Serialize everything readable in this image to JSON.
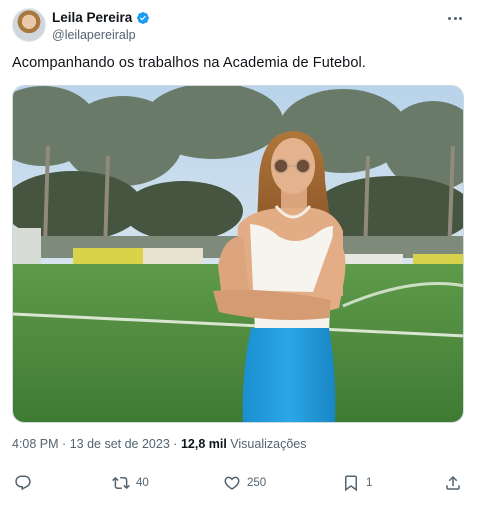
{
  "author": {
    "display_name": "Leila Pereira",
    "handle": "@leilapereiralp",
    "verified": true
  },
  "tweet": {
    "text": "Acompanhando os trabalhos na Academia de Futebol."
  },
  "meta": {
    "time": "4:08 PM",
    "separator1": "·",
    "date": "13 de set de 2023",
    "separator2": "·",
    "views_count": "12,8 mil",
    "views_label": "Visualizações"
  },
  "actions": {
    "reply_count": "",
    "retweet_count": "40",
    "like_count": "250",
    "bookmark_count": "1"
  },
  "icons": {
    "more": "more-options-icon",
    "reply": "reply-icon",
    "retweet": "retweet-icon",
    "like": "heart-icon",
    "bookmark": "bookmark-icon",
    "share": "share-icon",
    "verified": "verified-badge-icon"
  },
  "colors": {
    "verified_blue": "#1d9bf0",
    "muted_text": "#536471"
  }
}
